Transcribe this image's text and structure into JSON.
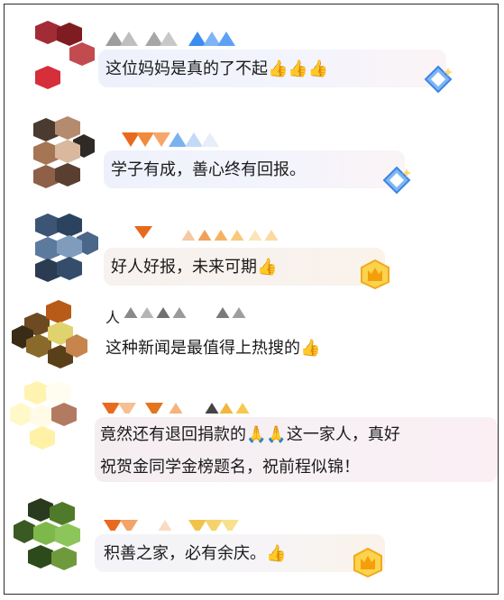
{
  "comments": [
    {
      "text": "这位妈妈是真的了不起👍👍👍"
    },
    {
      "text": "学子有成，善心终有回报。"
    },
    {
      "text": "好人好报，未来可期👍"
    },
    {
      "name_visible": "人",
      "text": "这种新闻是最值得上热搜的👍"
    },
    {
      "text_line1": "竟然还有退回捐款的🙏🙏这一家人，真好",
      "text_line2": "祝贺金同学金榜题名，祝前程似锦！"
    },
    {
      "text": "积善之家，必有余庆。👍"
    }
  ],
  "badges": [
    "blue-diamond-badge",
    "blue-diamond-badge",
    "gold-crown-badge",
    "gold-crown-badge"
  ],
  "colors": {
    "bubble_start": "#eef1fb",
    "bubble_end": "#fbf4f6",
    "text": "#1a1a1a"
  }
}
